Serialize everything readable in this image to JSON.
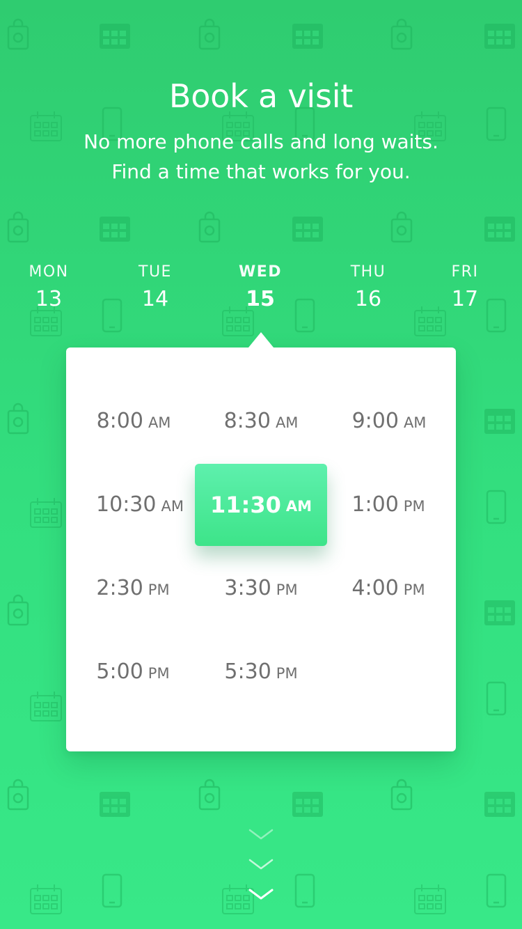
{
  "header": {
    "title": "Book a visit",
    "subtitle_line1": "No more phone calls and long waits.",
    "subtitle_line2": "Find a time that works for you."
  },
  "days": [
    {
      "dow": "MON",
      "date": "13",
      "active": false
    },
    {
      "dow": "TUE",
      "date": "14",
      "active": false
    },
    {
      "dow": "WED",
      "date": "15",
      "active": true
    },
    {
      "dow": "THU",
      "date": "16",
      "active": false
    },
    {
      "dow": "FRI",
      "date": "17",
      "active": false
    }
  ],
  "slots": [
    {
      "time": "8:00",
      "period": "AM"
    },
    {
      "time": "8:30",
      "period": "AM"
    },
    {
      "time": "9:00",
      "period": "AM"
    },
    {
      "time": "10:30",
      "period": "AM"
    },
    {
      "time": "11:30",
      "period": "AM",
      "selected": true
    },
    {
      "time": "1:00",
      "period": "PM"
    },
    {
      "time": "2:30",
      "period": "PM"
    },
    {
      "time": "3:30",
      "period": "PM"
    },
    {
      "time": "4:00",
      "period": "PM"
    },
    {
      "time": "5:00",
      "period": "PM"
    },
    {
      "time": "5:30",
      "period": "PM"
    }
  ],
  "colors": {
    "background_top": "#2fcc70",
    "background_bottom": "#38e888",
    "selected_top": "#5ef0ad",
    "selected_bottom": "#3de489",
    "slot_text": "#6f6f6f"
  },
  "icons": {
    "background_pattern": [
      "shopping-bag-icon",
      "calendar-icon",
      "phone-icon"
    ],
    "scroll_hint": "chevron-down-icon"
  }
}
